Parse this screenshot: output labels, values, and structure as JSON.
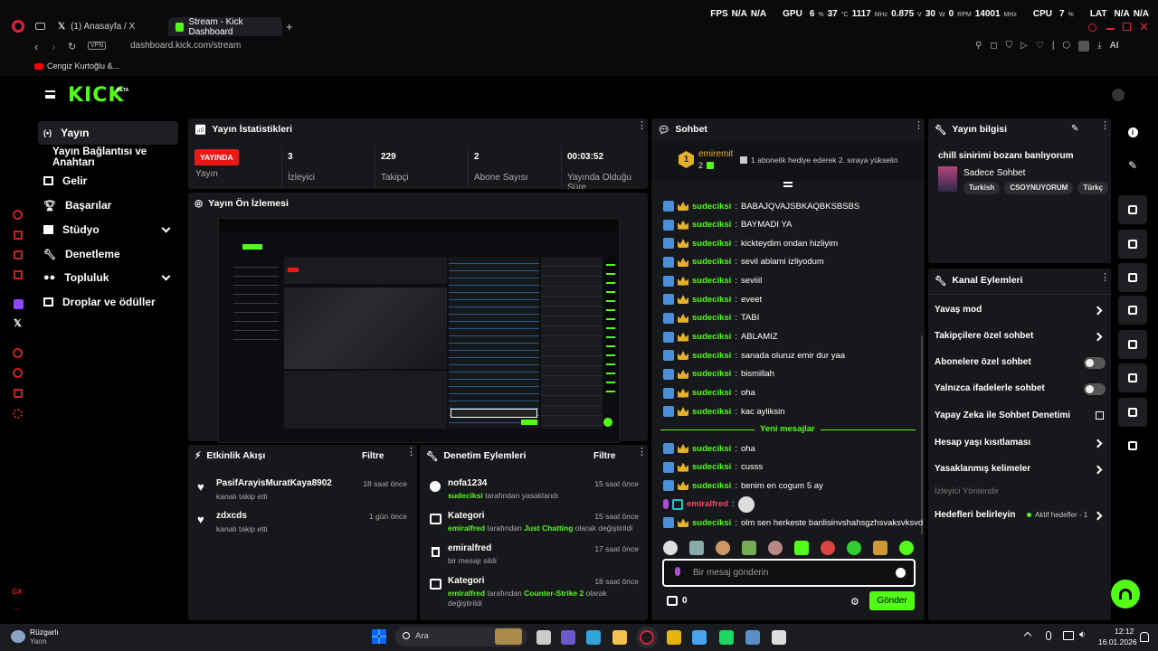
{
  "browser": {
    "tabs": [
      {
        "label": "(1) Anasayfa / X"
      },
      {
        "label": "Stream - Kick Dashboard"
      }
    ],
    "url": "dashboard.kick.com/stream",
    "vpn": "VPN",
    "bookmark": "Cengiz Kurtoğlu &...",
    "ai_label": "AI"
  },
  "hud": {
    "fps_label": "FPS",
    "fps1": "N/A",
    "fps2": "N/A",
    "gpu_label": "GPU",
    "gpu_pct": "6",
    "gpu_temp": "37",
    "gpu_mhz": "1117",
    "gpu_v": "0.875",
    "gpu_w": "30",
    "gpu_rpm": "0",
    "gpu_mem": "14001",
    "cpu_label": "CPU",
    "cpu_pct": "7",
    "lat_label": "LAT",
    "lat1": "N/A",
    "lat2": "N/A",
    "u_pct": "%",
    "u_c": "°C",
    "u_mhz": "MHz",
    "u_v": "V",
    "u_w": "W",
    "u_rpm": "RPM"
  },
  "kick": {
    "logo": "KICK",
    "beta": "BETA"
  },
  "sidebar": {
    "items": [
      {
        "label": "Yayın"
      },
      {
        "label": "Yayın Bağlantısı ve Anahtarı"
      },
      {
        "label": "Gelir"
      },
      {
        "label": "Başarılar"
      },
      {
        "label": "Stüdyo"
      },
      {
        "label": "Denetleme"
      },
      {
        "label": "Topluluk"
      },
      {
        "label": "Droplar ve ödüller"
      }
    ]
  },
  "stats": {
    "title": "Yayın İstatistikleri",
    "live_badge": "YAYINDA",
    "items": [
      {
        "value": "",
        "label": "Yayın"
      },
      {
        "value": "3",
        "label": "İzleyici"
      },
      {
        "value": "229",
        "label": "Takipçi"
      },
      {
        "value": "2",
        "label": "Abone Sayısı"
      },
      {
        "value": "00:03:52",
        "label": "Yayında Olduğu Süre"
      }
    ]
  },
  "preview": {
    "title": "Yayın Ön İzlemesi"
  },
  "activity": {
    "title": "Etkinlik Akışı",
    "filter": "Filtre",
    "items": [
      {
        "name": "PasifArayisMuratKaya8902",
        "desc": "kanalı takip etti",
        "time": "18 saat önce"
      },
      {
        "name": "zdxcds",
        "desc": "kanalı takip etti",
        "time": "1 gün önce"
      }
    ]
  },
  "moderation": {
    "title": "Denetim Eylemleri",
    "filter": "Filtre",
    "items": [
      {
        "name": "nofa1234",
        "who": "sudeciksi",
        "rest": " tarafından yasaklandı",
        "time": "15 saat önce"
      },
      {
        "name": "Kategori",
        "who": "emiralfred",
        "rest": " tarafından ",
        "cat": "Just Chatting",
        "rest2": " olarak değiştirildi",
        "time": "15 saat önce"
      },
      {
        "name": "emiralfred",
        "desc": "bir mesajı sildi",
        "time": "17 saat önce"
      },
      {
        "name": "Kategori",
        "who": "emiralfred",
        "rest": " tarafından ",
        "cat": "Counter-Strike 2",
        "rest2": " olarak",
        "line2": "değiştirildi",
        "time": "18 saat önce"
      }
    ]
  },
  "chat": {
    "title": "Sohbet",
    "top_user": "emiremit",
    "top_rank": "1",
    "top_count": "2",
    "gift_note": "1 abonelik hediye ederek 2. sıraya yükselin",
    "messages": [
      {
        "user": "sudeciksi",
        "text": "BABAJQVAJSBKAQBKSBSBS"
      },
      {
        "user": "sudeciksi",
        "text": "BAYMADI YA"
      },
      {
        "user": "sudeciksi",
        "text": "kickteydim ondan hizliyim"
      },
      {
        "user": "sudeciksi",
        "text": "sevil ablami izliyodum"
      },
      {
        "user": "sudeciksi",
        "text": "seviiil"
      },
      {
        "user": "sudeciksi",
        "text": "eveet"
      },
      {
        "user": "sudeciksi",
        "text": "TABI"
      },
      {
        "user": "sudeciksi",
        "text": "ABLAMIZ"
      },
      {
        "user": "sudeciksi",
        "text": "sanada oluruz emir dur yaa"
      },
      {
        "user": "sudeciksi",
        "text": "bismillah"
      },
      {
        "user": "sudeciksi",
        "text": "oha"
      },
      {
        "user": "sudeciksi",
        "text": "kac ayliksin"
      }
    ],
    "new_label": "Yeni mesajlar",
    "new_messages": [
      {
        "user": "sudeciksi",
        "text": "oha"
      },
      {
        "user": "sudeciksi",
        "text": "cusss"
      },
      {
        "user": "sudeciksi",
        "text": "benim en cogum 5 ay"
      },
      {
        "user": "emiralfred",
        "text": ""
      },
      {
        "user": "sudeciksi",
        "text": "olm sen herkeste banlisinvshahsgzhsvaksvksvd"
      }
    ],
    "input_placeholder": "Bir mesaj gönderin",
    "points": "0",
    "send": "Gönder"
  },
  "streaminfo": {
    "title": "Yayın bilgisi",
    "stream_title": "chill sinirimi bozanı banlıyorum",
    "category": "Sadece Sohbet",
    "tags": [
      "Turkish",
      "CSOYNUYORUM",
      "Türkç"
    ]
  },
  "channel": {
    "title": "Kanal Eylemleri",
    "rows": [
      {
        "label": "Yavaş mod"
      },
      {
        "label": "Takipçilere özel sohbet"
      },
      {
        "label": "Abonelere özel sohbet"
      },
      {
        "label": "Yalnızca ifadelerle sohbet"
      },
      {
        "label": "Yapay Zeka ile Sohbet Denetimi"
      },
      {
        "label": "Hesap yaşı kısıtlaması"
      },
      {
        "label": "Yasaklanmış kelimeler"
      },
      {
        "label": "İzleyici Yönlendir"
      },
      {
        "label": "Hedefleri belirleyin"
      }
    ],
    "goal_status": "Aktif hedefler - 1"
  },
  "taskbar": {
    "weather_title": "Rüzgarlı",
    "weather_sub": "Yarın",
    "search": "Ara",
    "time": "12:12",
    "date": "16.01.2026"
  }
}
